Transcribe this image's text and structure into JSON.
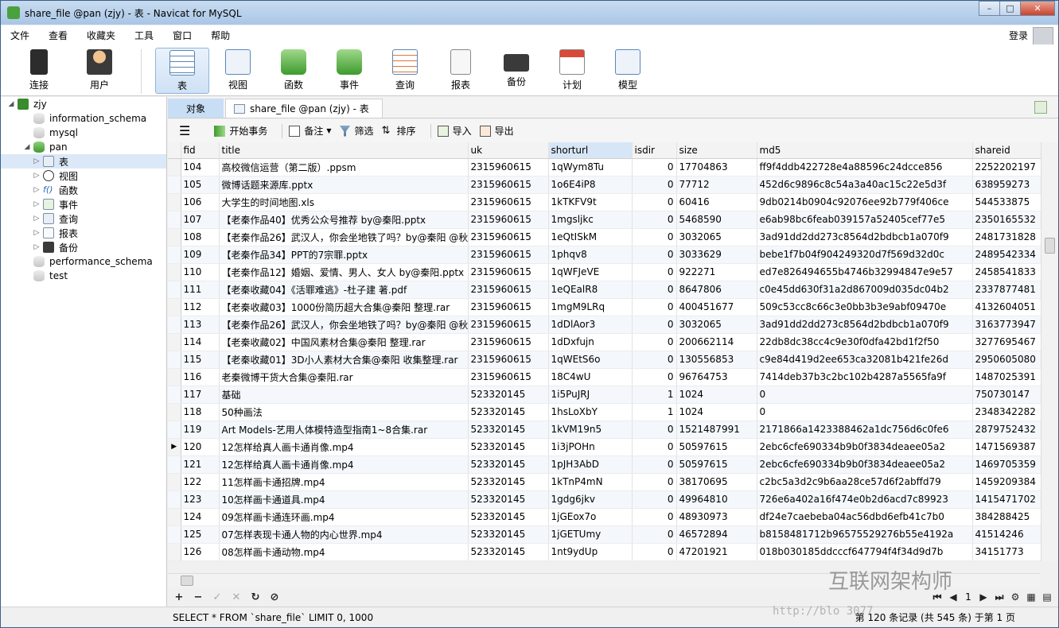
{
  "window": {
    "title": "share_file @pan (zjy) - 表 - Navicat for MySQL"
  },
  "menu": [
    "文件",
    "查看",
    "收藏夹",
    "工具",
    "窗口",
    "帮助"
  ],
  "login_label": "登录",
  "toolbar": {
    "connect": "连接",
    "user": "用户",
    "items": [
      "表",
      "视图",
      "函数",
      "事件",
      "查询",
      "报表",
      "备份",
      "计划",
      "模型"
    ]
  },
  "sidebar": {
    "connection": "zjy",
    "databases": [
      "information_schema",
      "mysql",
      "pan",
      "performance_schema",
      "test"
    ],
    "pan_children": [
      "表",
      "视图",
      "函数",
      "事件",
      "查询",
      "报表",
      "备份"
    ]
  },
  "tabs": {
    "objects": "对象",
    "doc": "share_file @pan (zjy) - 表"
  },
  "grid_toolbar": {
    "begin_tx": "开始事务",
    "note": "备注",
    "filter": "筛选",
    "sort": "排序",
    "import": "导入",
    "export": "导出"
  },
  "columns": [
    "fid",
    "title",
    "uk",
    "shorturl",
    "isdir",
    "size",
    "md5",
    "shareid"
  ],
  "rows": [
    [
      "104",
      "高校微信运营（第二版）.ppsm",
      "2315960615",
      "1qWym8Tu",
      "0",
      "17704863",
      "ff9f4ddb422728e4a88596c24dcce856",
      "2252202197"
    ],
    [
      "105",
      "微博话题来源库.pptx",
      "2315960615",
      "1o6E4iP8",
      "0",
      "77712",
      "452d6c9896c8c54a3a40ac15c22e5d3f",
      "638959273"
    ],
    [
      "106",
      "大学生的时间地图.xls",
      "2315960615",
      "1kTKFV9t",
      "0",
      "60416",
      "9db0214b0904c92076ee92b779f406ce",
      "544533875"
    ],
    [
      "107",
      "【老秦作品40】优秀公众号推荐 by@秦阳.pptx",
      "2315960615",
      "1mgsljkc",
      "0",
      "5468590",
      "e6ab98bc6feab039157a52405cef77e5",
      "2350165532"
    ],
    [
      "108",
      "【老秦作品26】武汉人，你会坐地铁了吗？by@秦阳 @秋",
      "2315960615",
      "1eQtISkM",
      "0",
      "3032065",
      "3ad91dd2dd273c8564d2bdbcb1a070f9",
      "2481731828"
    ],
    [
      "109",
      "【老秦作品34】PPT的7宗罪.pptx",
      "2315960615",
      "1phqv8",
      "0",
      "3033629",
      "bebe1f7b04f904249320d7f569d32d0c",
      "2489542334"
    ],
    [
      "110",
      "【老秦作品12】婚姻、爱情、男人、女人 by@秦阳.pptx",
      "2315960615",
      "1qWFJeVE",
      "0",
      "922271",
      "ed7e826494655b4746b32994847e9e57",
      "2458541833"
    ],
    [
      "111",
      "【老秦收藏04】《活罪难逃》-杜子建 著.pdf",
      "2315960615",
      "1eQEalR8",
      "0",
      "8647806",
      "c0e45dd630f31a2d867009d035dc04b2",
      "2337877481"
    ],
    [
      "112",
      "【老秦收藏03】1000份简历超大合集@秦阳 整理.rar",
      "2315960615",
      "1mgM9LRq",
      "0",
      "400451677",
      "509c53cc8c66c3e0bb3b3e9abf09470e",
      "4132604051"
    ],
    [
      "113",
      "【老秦作品26】武汉人，你会坐地铁了吗？by@秦阳 @秋",
      "2315960615",
      "1dDlAor3",
      "0",
      "3032065",
      "3ad91dd2dd273c8564d2bdbcb1a070f9",
      "3163773947"
    ],
    [
      "114",
      "【老秦收藏02】中国风素材合集@秦阳 整理.rar",
      "2315960615",
      "1dDxfujn",
      "0",
      "200662114",
      "22db8dc38cc4c9e30f0dfa42bd1f2f50",
      "3277695467"
    ],
    [
      "115",
      "【老秦收藏01】3D小人素材大合集@秦阳 收集整理.rar",
      "2315960615",
      "1qWEtS6o",
      "0",
      "130556853",
      "c9e84d419d2ee653ca32081b421fe26d",
      "2950605080"
    ],
    [
      "116",
      "老秦微博干货大合集@秦阳.rar",
      "2315960615",
      "18C4wU",
      "0",
      "96764753",
      "7414deb37b3c2bc102b4287a5565fa9f",
      "1487025391"
    ],
    [
      "117",
      "基础",
      "523320145",
      "1i5PuJRJ",
      "1",
      "1024",
      "0",
      "750730147"
    ],
    [
      "118",
      "50种画法",
      "523320145",
      "1hsLoXbY",
      "1",
      "1024",
      "0",
      "2348342282"
    ],
    [
      "119",
      "Art Models-艺用人体模特造型指南1~8合集.rar",
      "523320145",
      "1kVM19n5",
      "0",
      "1521487991",
      "2171866a1423388462a1dc756d6c0fe6",
      "2879752432"
    ],
    [
      "120",
      "12怎样给真人画卡通肖像.mp4",
      "523320145",
      "1i3jPOHn",
      "0",
      "50597615",
      "2ebc6cfe690334b9b0f3834deaee05a2",
      "1471569387"
    ],
    [
      "121",
      "12怎样给真人画卡通肖像.mp4",
      "523320145",
      "1pJH3AbD",
      "0",
      "50597615",
      "2ebc6cfe690334b9b0f3834deaee05a2",
      "1469705359"
    ],
    [
      "122",
      "11怎样画卡通招牌.mp4",
      "523320145",
      "1kTnP4mN",
      "0",
      "38170695",
      "c2bc5a3d2c9b6aa28ce57d6f2abffd79",
      "1459209384"
    ],
    [
      "123",
      "10怎样画卡通道具.mp4",
      "523320145",
      "1gdg6jkv",
      "0",
      "49964810",
      "726e6a402a16f474e0b2d6acd7c89923",
      "1415471702"
    ],
    [
      "124",
      "09怎样画卡通连环画.mp4",
      "523320145",
      "1jGEox7o",
      "0",
      "48930973",
      "df24e7caebeba04ac56dbd6efb41c7b0",
      "384288425"
    ],
    [
      "125",
      "07怎样表现卡通人物的内心世界.mp4",
      "523320145",
      "1jGETUmy",
      "0",
      "46572894",
      "b8158481712b96575529276b55e4192a",
      "41514246"
    ],
    [
      "126",
      "08怎样画卡通动物.mp4",
      "523320145",
      "1nt9ydUp",
      "0",
      "47201921",
      "018b030185ddcccf647794f4f34d9d7b",
      "34151773"
    ]
  ],
  "current_row_fid": "120",
  "sorted_column": "shorturl",
  "navigation": {
    "page": "1"
  },
  "status": {
    "sql": "SELECT * FROM `share_file` LIMIT 0, 1000",
    "record_info": "第 120 条记录 (共 545 条) 于第 1 页"
  },
  "watermark": {
    "text": "互联网架构师",
    "url": "http://blo                 3077"
  }
}
